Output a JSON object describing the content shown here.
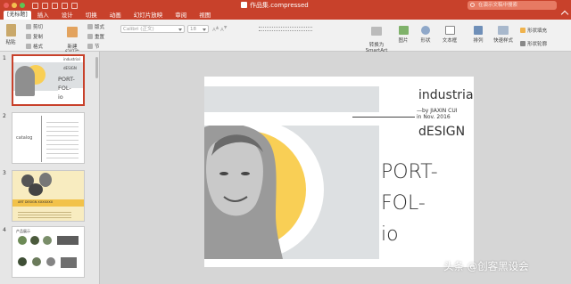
{
  "window": {
    "title": "作品集.compressed",
    "search_placeholder": "在演示文稿中搜索"
  },
  "tabs": [
    {
      "label": "[无标题]"
    },
    {
      "label": "插入"
    },
    {
      "label": "设计"
    },
    {
      "label": "切换"
    },
    {
      "label": "动画"
    },
    {
      "label": "幻灯片放映"
    },
    {
      "label": "审阅"
    },
    {
      "label": "视图"
    }
  ],
  "ribbon": {
    "paste": "粘贴",
    "cut": "剪切",
    "copy": "复制",
    "format": "格式",
    "new_slide": "新建\n幻灯片",
    "layout": "版式",
    "reset": "重置",
    "section": "节",
    "font_name": "Calibri (正文)",
    "font_size": "18",
    "convert_smartart": "转换为\nSmartArt",
    "picture": "图片",
    "shape": "形状",
    "textbox": "文本框",
    "arrange": "排列",
    "quick_styles": "快速样式",
    "shape_fill": "形状填充",
    "shape_outline": "形状轮廓"
  },
  "thumbnails": [
    {
      "number": "1",
      "selected": true,
      "lines": [
        "industrial",
        "dESIGN",
        "PORT-",
        "FOL-",
        "io"
      ]
    },
    {
      "number": "2",
      "selected": false,
      "lines": [
        "catalog"
      ]
    },
    {
      "number": "3",
      "selected": false,
      "lines": [
        "ART DESIGN XXXXXXX"
      ]
    },
    {
      "number": "4",
      "selected": false,
      "lines": [
        "产品展示"
      ]
    }
  ],
  "slide": {
    "title_top": "industrial",
    "byline": "—by JIAXIN CUI",
    "date": "in Nov. 2016",
    "subtitle": "dESIGN",
    "big_1": "PORT-",
    "big_2": "FOL-",
    "big_3": "io",
    "accent_color": "#f9cf55",
    "band_color": "#dde0e2"
  },
  "watermark": "头条 @创客黑设会"
}
